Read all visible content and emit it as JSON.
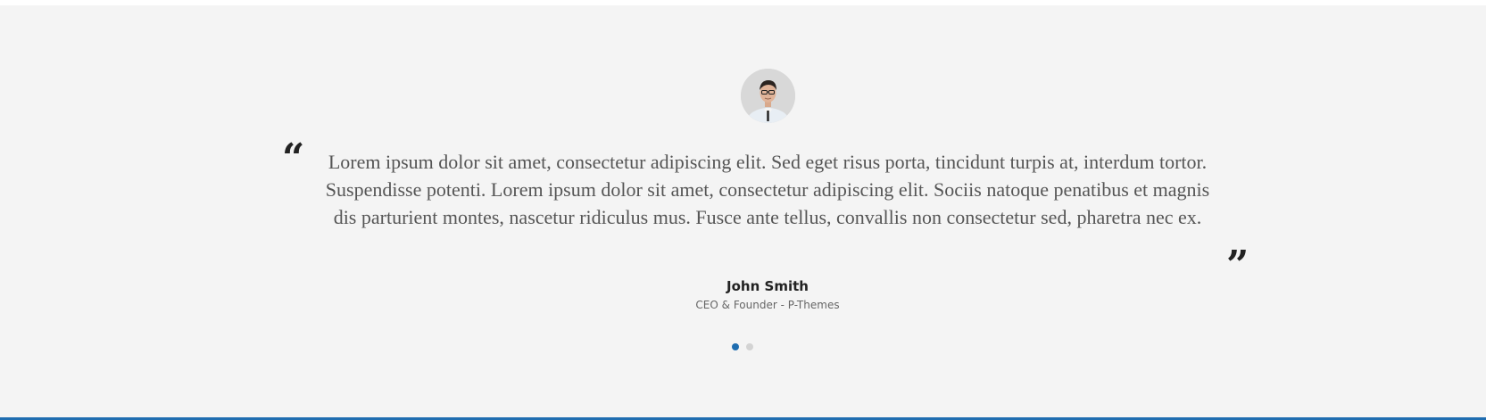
{
  "testimonial": {
    "quote": "Lorem ipsum dolor sit amet, consectetur adipiscing elit. Sed eget risus porta, tincidunt turpis at, interdum tortor. Suspendisse potenti. Lorem ipsum dolor sit amet, consectetur adipiscing elit. Sociis natoque penatibus et magnis dis parturient montes, nascetur ridiculus mus. Fusce ante tellus, convallis non consectetur sed, pharetra nec ex.",
    "author_name": "John Smith",
    "author_role": "CEO & Founder - P-Themes",
    "open_quote_glyph": "“",
    "close_quote_glyph": "”"
  },
  "slider": {
    "slide_count": 2,
    "active_index": 0
  },
  "colors": {
    "background": "#f4f4f4",
    "accent": "#1f6db0",
    "text": "#555555",
    "dot_inactive": "#d3d3d3"
  },
  "icons": {
    "avatar": "person-avatar-icon",
    "open_quote": "open-quote-icon",
    "close_quote": "close-quote-icon"
  }
}
